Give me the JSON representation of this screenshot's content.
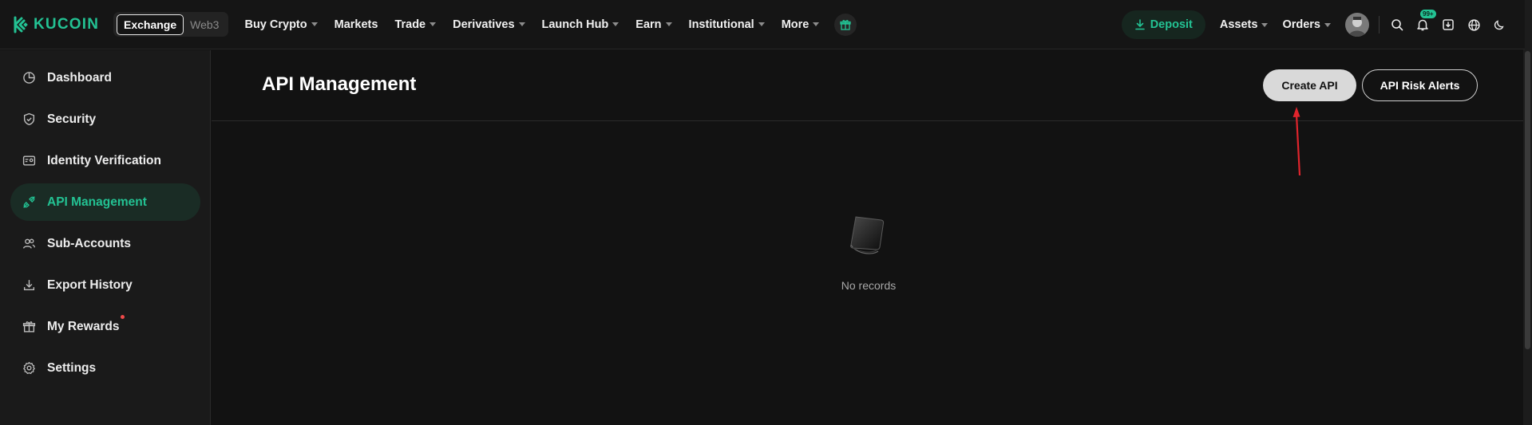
{
  "brand": {
    "name": "KUCOIN",
    "color": "#23c293"
  },
  "mode_switch": {
    "active": "Exchange",
    "inactive": "Web3"
  },
  "nav": {
    "items": [
      {
        "label": "Buy Crypto",
        "dropdown": true
      },
      {
        "label": "Markets",
        "dropdown": false
      },
      {
        "label": "Trade",
        "dropdown": true
      },
      {
        "label": "Derivatives",
        "dropdown": true
      },
      {
        "label": "Launch Hub",
        "dropdown": true
      },
      {
        "label": "Earn",
        "dropdown": true
      },
      {
        "label": "Institutional",
        "dropdown": true
      },
      {
        "label": "More",
        "dropdown": true
      }
    ],
    "gift_icon": "gift-icon"
  },
  "header_right": {
    "deposit_label": "Deposit",
    "assets_label": "Assets",
    "orders_label": "Orders",
    "notification_badge": "99+",
    "icons": [
      "search-icon",
      "bell-icon",
      "download-icon",
      "globe-icon",
      "moon-icon"
    ]
  },
  "sidebar": {
    "items": [
      {
        "label": "Dashboard",
        "icon": "pie-chart-icon",
        "active": false
      },
      {
        "label": "Security",
        "icon": "shield-icon",
        "active": false
      },
      {
        "label": "Identity Verification",
        "icon": "id-card-icon",
        "active": false
      },
      {
        "label": "API Management",
        "icon": "api-icon",
        "active": true
      },
      {
        "label": "Sub-Accounts",
        "icon": "users-icon",
        "active": false
      },
      {
        "label": "Export History",
        "icon": "download-icon",
        "active": false
      },
      {
        "label": "My Rewards",
        "icon": "gift-icon",
        "active": false,
        "dot": true
      },
      {
        "label": "Settings",
        "icon": "gear-icon",
        "active": false
      }
    ]
  },
  "main": {
    "title": "API Management",
    "create_button": "Create API",
    "alerts_button": "API Risk Alerts",
    "empty_text": "No records"
  },
  "colors": {
    "accent": "#23c293",
    "annotation_arrow": "#e0242c",
    "notification_dot": "#f04a4a"
  }
}
